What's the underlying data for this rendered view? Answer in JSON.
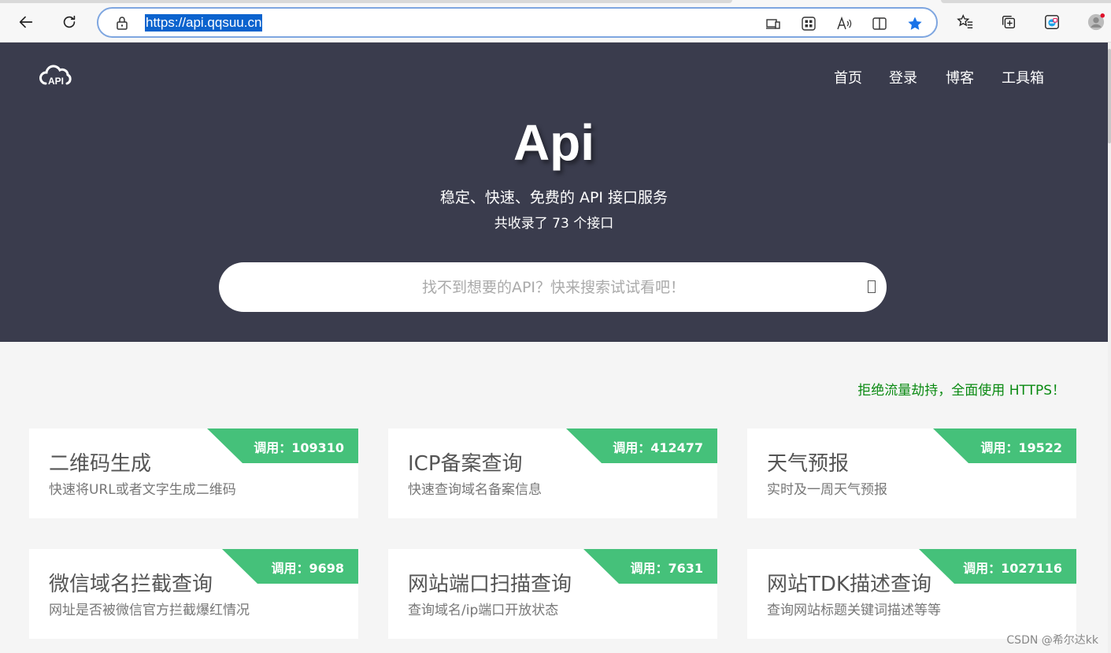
{
  "browser": {
    "url": "https://api.qqsuu.cn",
    "icons": [
      "back-icon",
      "refresh-icon",
      "lock-icon",
      "device-icon",
      "apps-icon",
      "read-aloud-icon",
      "split-screen-icon",
      "star-icon",
      "favorites-icon",
      "collections-icon",
      "edge-icon",
      "profile-icon"
    ]
  },
  "site": {
    "logo_text": "API",
    "nav": [
      "首页",
      "登录",
      "博客",
      "工具箱"
    ],
    "title": "Api",
    "subtitle": "稳定、快速、免费的 API 接口服务",
    "count_text": "共收录了 73 个接口",
    "search_placeholder": "找不到想要的API？快来搜索试试看吧！",
    "notice": "拒绝流量劫持，全面使用 HTTPS！"
  },
  "cards": [
    {
      "title": "二维码生成",
      "desc": "快速将URL或者文字生成二维码",
      "calls": "调用：109310"
    },
    {
      "title": "ICP备案查询",
      "desc": "快速查询域名备案信息",
      "calls": "调用：412477"
    },
    {
      "title": "天气预报",
      "desc": "实时及一周天气预报",
      "calls": "调用：19522"
    },
    {
      "title": "微信域名拦截查询",
      "desc": "网址是否被微信官方拦截爆红情况",
      "calls": "调用：9698"
    },
    {
      "title": "网站端口扫描查询",
      "desc": "查询域名/ip端口开放状态",
      "calls": "调用：7631"
    },
    {
      "title": "网站TDK描述查询",
      "desc": "查询网站标题关键词描述等等",
      "calls": "调用：1027116"
    }
  ],
  "watermark": "CSDN @希尔达kk",
  "colors": {
    "hero_bg": "#3a3c4d",
    "ribbon": "#45c17a",
    "notice": "#0a8a12"
  }
}
